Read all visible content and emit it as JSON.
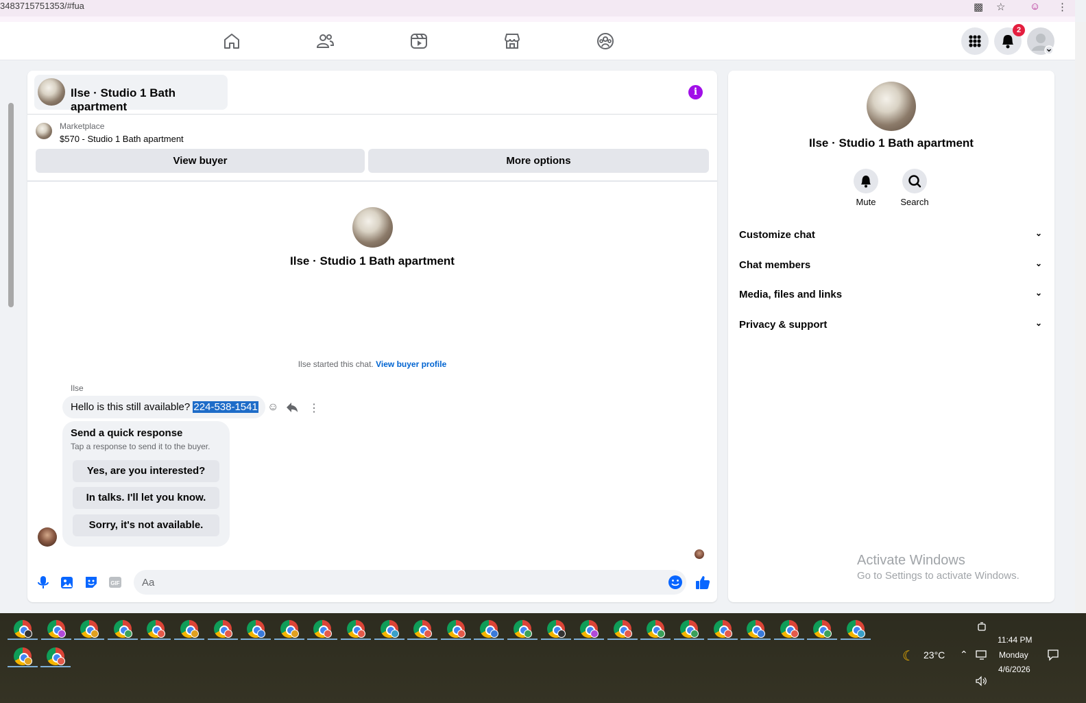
{
  "browser": {
    "url": "3483715751353/#fua"
  },
  "notifications": {
    "count": "2"
  },
  "chat": {
    "title": "Ilse · Studio 1 Bath apartment",
    "listing": {
      "label": "Marketplace",
      "title": "$570 - Studio 1 Bath apartment"
    },
    "view_buyer": "View buyer",
    "more_options": "More options",
    "center_title": "Ilse · Studio 1 Bath apartment",
    "started_text": "Ilse started this chat.",
    "view_profile": "View buyer profile",
    "sender": "Ilse",
    "message_text": "Hello is this still available? ",
    "message_phone": "224-538-1541",
    "quick": {
      "title": "Send a quick response",
      "subtitle": "Tap a response to send it to the buyer.",
      "options": [
        "Yes, are you interested?",
        "In talks. I'll let you know.",
        "Sorry, it's not available."
      ]
    },
    "composer_placeholder": "Aa"
  },
  "info": {
    "name": "Ilse · Studio 1 Bath apartment",
    "mute": "Mute",
    "search": "Search",
    "sections": [
      "Customize chat",
      "Chat members",
      "Media, files and links",
      "Privacy & support"
    ]
  },
  "watermark": {
    "line1": "Activate Windows",
    "line2": "Go to Settings to activate Windows."
  },
  "tray": {
    "weather": "23°C",
    "time": "11:44 PM",
    "day": "Monday",
    "date": "4/6/2026"
  },
  "colors": {
    "accent": "#0866ff",
    "info": "#a10fe8",
    "badge": "#e41e3f"
  }
}
